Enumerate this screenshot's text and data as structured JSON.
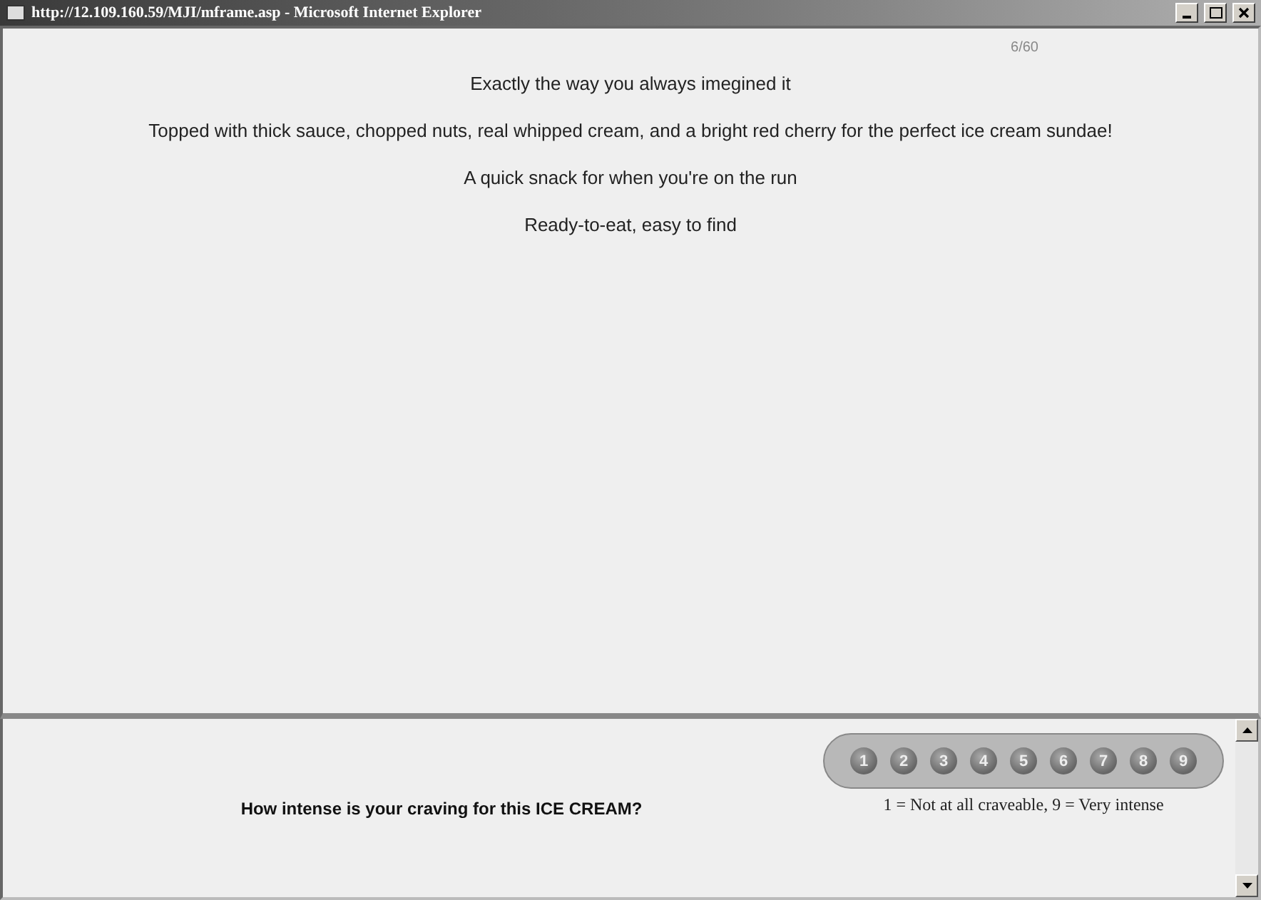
{
  "window": {
    "title": "http://12.109.160.59/MJI/mframe.asp - Microsoft Internet Explorer"
  },
  "counter": "6/60",
  "lines": [
    "Exactly the way you always imegined it",
    "Topped with thick sauce, chopped nuts, real whipped cream, and a bright red cherry for the perfect ice cream sundae!",
    "A quick snack for when you're on the run",
    "Ready-to-eat, easy to find"
  ],
  "question": "How intense is your craving for this ICE CREAM?",
  "ratings": [
    "1",
    "2",
    "3",
    "4",
    "5",
    "6",
    "7",
    "8",
    "9"
  ],
  "scale_note": "1 = Not at all craveable, 9 = Very intense"
}
